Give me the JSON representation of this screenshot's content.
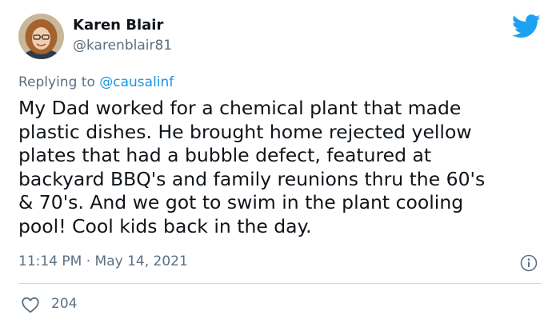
{
  "author": {
    "name": "Karen Blair",
    "handle": "@karenblair81",
    "avatar_icon": "user-avatar-photo"
  },
  "brand": {
    "icon": "twitter-bird-icon",
    "color": "#1da1f2"
  },
  "reply": {
    "prefix": "Replying to",
    "mention": "@causalinf"
  },
  "tweet": {
    "lines": [
      "My Dad worked for a chemical plant that made",
      "plastic dishes. He brought home rejected yellow",
      "plates that had a bubble defect, featured at",
      "backyard BBQ's and family reunions thru the 60's",
      "& 70's. And we got to swim in the plant cooling",
      "pool! Cool kids back in the day."
    ]
  },
  "meta": {
    "time": "11:14 PM",
    "separator": "·",
    "date": "May 14, 2021",
    "info_icon": "info-icon"
  },
  "stats": {
    "like_icon": "heart-icon",
    "likes": "204"
  },
  "colors": {
    "text": "#0f1419",
    "secondary": "#5b7083",
    "link": "#1b95e0",
    "divider": "#cfd9de"
  }
}
